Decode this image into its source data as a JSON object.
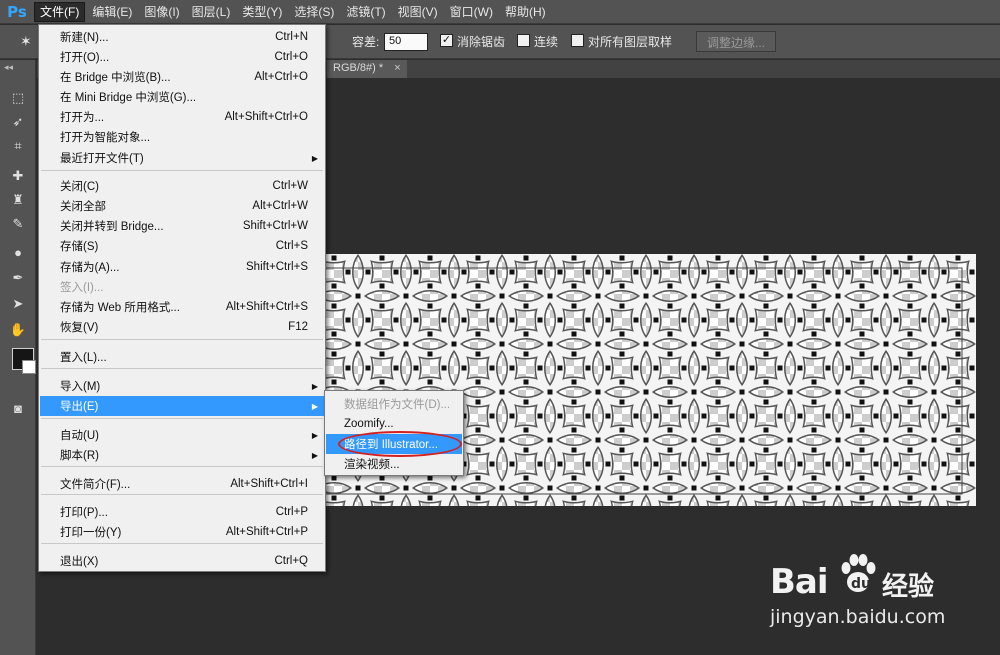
{
  "app": {
    "logo": "Ps"
  },
  "menubar": {
    "items": [
      {
        "label": "文件(F)"
      },
      {
        "label": "编辑(E)"
      },
      {
        "label": "图像(I)"
      },
      {
        "label": "图层(L)"
      },
      {
        "label": "类型(Y)"
      },
      {
        "label": "选择(S)"
      },
      {
        "label": "滤镜(T)"
      },
      {
        "label": "视图(V)"
      },
      {
        "label": "窗口(W)"
      },
      {
        "label": "帮助(H)"
      }
    ],
    "active_index": 0
  },
  "options": {
    "tolerance_label": "容差:",
    "tolerance_value": "50",
    "antialias_label": "消除锯齿",
    "antialias_checked": "✓",
    "contiguous_label": "连续",
    "sample_all_label": "对所有图层取样",
    "refine_edge_label": "调整边缘..."
  },
  "document": {
    "tab_label": "RGB/8#) *",
    "close": "×"
  },
  "file_menu": {
    "items": [
      {
        "label": "新建(N)...",
        "shortcut": "Ctrl+N"
      },
      {
        "label": "打开(O)...",
        "shortcut": "Ctrl+O"
      },
      {
        "label": "在 Bridge 中浏览(B)...",
        "shortcut": "Alt+Ctrl+O"
      },
      {
        "label": "在 Mini Bridge 中浏览(G)...",
        "shortcut": ""
      },
      {
        "label": "打开为...",
        "shortcut": "Alt+Shift+Ctrl+O"
      },
      {
        "label": "打开为智能对象...",
        "shortcut": ""
      },
      {
        "label": "最近打开文件(T)",
        "shortcut": "",
        "submenu": true
      },
      {
        "label": "关闭(C)",
        "shortcut": "Ctrl+W"
      },
      {
        "label": "关闭全部",
        "shortcut": "Alt+Ctrl+W"
      },
      {
        "label": "关闭并转到 Bridge...",
        "shortcut": "Shift+Ctrl+W"
      },
      {
        "label": "存储(S)",
        "shortcut": "Ctrl+S"
      },
      {
        "label": "存储为(A)...",
        "shortcut": "Shift+Ctrl+S"
      },
      {
        "label": "签入(I)...",
        "shortcut": "",
        "disabled": true
      },
      {
        "label": "存储为 Web 所用格式...",
        "shortcut": "Alt+Shift+Ctrl+S"
      },
      {
        "label": "恢复(V)",
        "shortcut": "F12"
      },
      {
        "label": "置入(L)...",
        "shortcut": ""
      },
      {
        "label": "导入(M)",
        "shortcut": "",
        "submenu": true
      },
      {
        "label": "导出(E)",
        "shortcut": "",
        "submenu": true,
        "selected": true
      },
      {
        "label": "自动(U)",
        "shortcut": "",
        "submenu": true
      },
      {
        "label": "脚本(R)",
        "shortcut": "",
        "submenu": true
      },
      {
        "label": "文件简介(F)...",
        "shortcut": "Alt+Shift+Ctrl+I"
      },
      {
        "label": "打印(P)...",
        "shortcut": "Ctrl+P"
      },
      {
        "label": "打印一份(Y)",
        "shortcut": "Alt+Shift+Ctrl+P"
      },
      {
        "label": "退出(X)",
        "shortcut": "Ctrl+Q"
      }
    ]
  },
  "export_submenu": {
    "items": [
      {
        "label": "数据组作为文件(D)...",
        "disabled": true
      },
      {
        "label": "Zoomify..."
      },
      {
        "label": "路径到 Illustrator...",
        "selected": true
      },
      {
        "label": "渲染视频..."
      }
    ]
  },
  "watermark": {
    "brand": "Bai",
    "brand2": "du",
    "product": "经验",
    "url": "jingyan.baidu.com"
  },
  "colors": {
    "accent": "#3399ff",
    "ring": "#d42020",
    "ps_blue": "#31a8ff"
  }
}
